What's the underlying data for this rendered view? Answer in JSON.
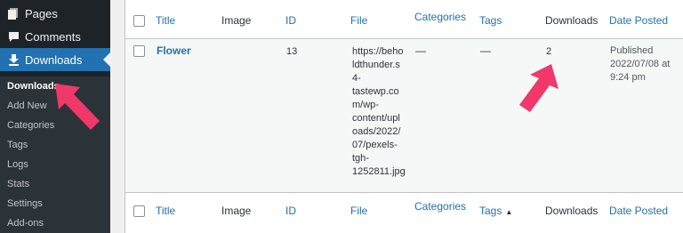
{
  "sidebar": {
    "menu": [
      {
        "label": "Pages",
        "icon": "pages-icon"
      },
      {
        "label": "Comments",
        "icon": "comments-icon"
      },
      {
        "label": "Downloads",
        "icon": "download-icon"
      }
    ],
    "submenu": [
      "Downloads",
      "Add New",
      "Categories",
      "Tags",
      "Logs",
      "Stats",
      "Settings",
      "Add-ons"
    ]
  },
  "table": {
    "columns": {
      "title": "Title",
      "image": "Image",
      "id": "ID",
      "file": "File",
      "categories": "Categories",
      "tags": "Tags",
      "downloads": "Downloads",
      "date": "Date Posted"
    },
    "tags_sort_indicator": "▲",
    "rows": [
      {
        "title": "Flower",
        "id": "13",
        "file": "https://beholdthunder.s4-tastewp.com/wp-content/uploads/2022/07/pexels-tgh-1252811.jpg",
        "file_lines": [
          "https://beho",
          "ldthunder.s",
          "4-",
          "tastewp.co",
          "m/wp-",
          "content/upl",
          "oads/2022/",
          "07/pexels-",
          "tgh-",
          "1252811.jpg"
        ],
        "categories": "—",
        "tags": "—",
        "downloads": "2",
        "date_lines": [
          "Published",
          "2022/07/08 at",
          "9:24 pm"
        ]
      }
    ]
  },
  "colors": {
    "sidebar_bg": "#1d2327",
    "submenu_bg": "#2c3338",
    "active_menu": "#2271b1",
    "link": "#2271b1",
    "annotation_arrow": "#f0386b"
  }
}
